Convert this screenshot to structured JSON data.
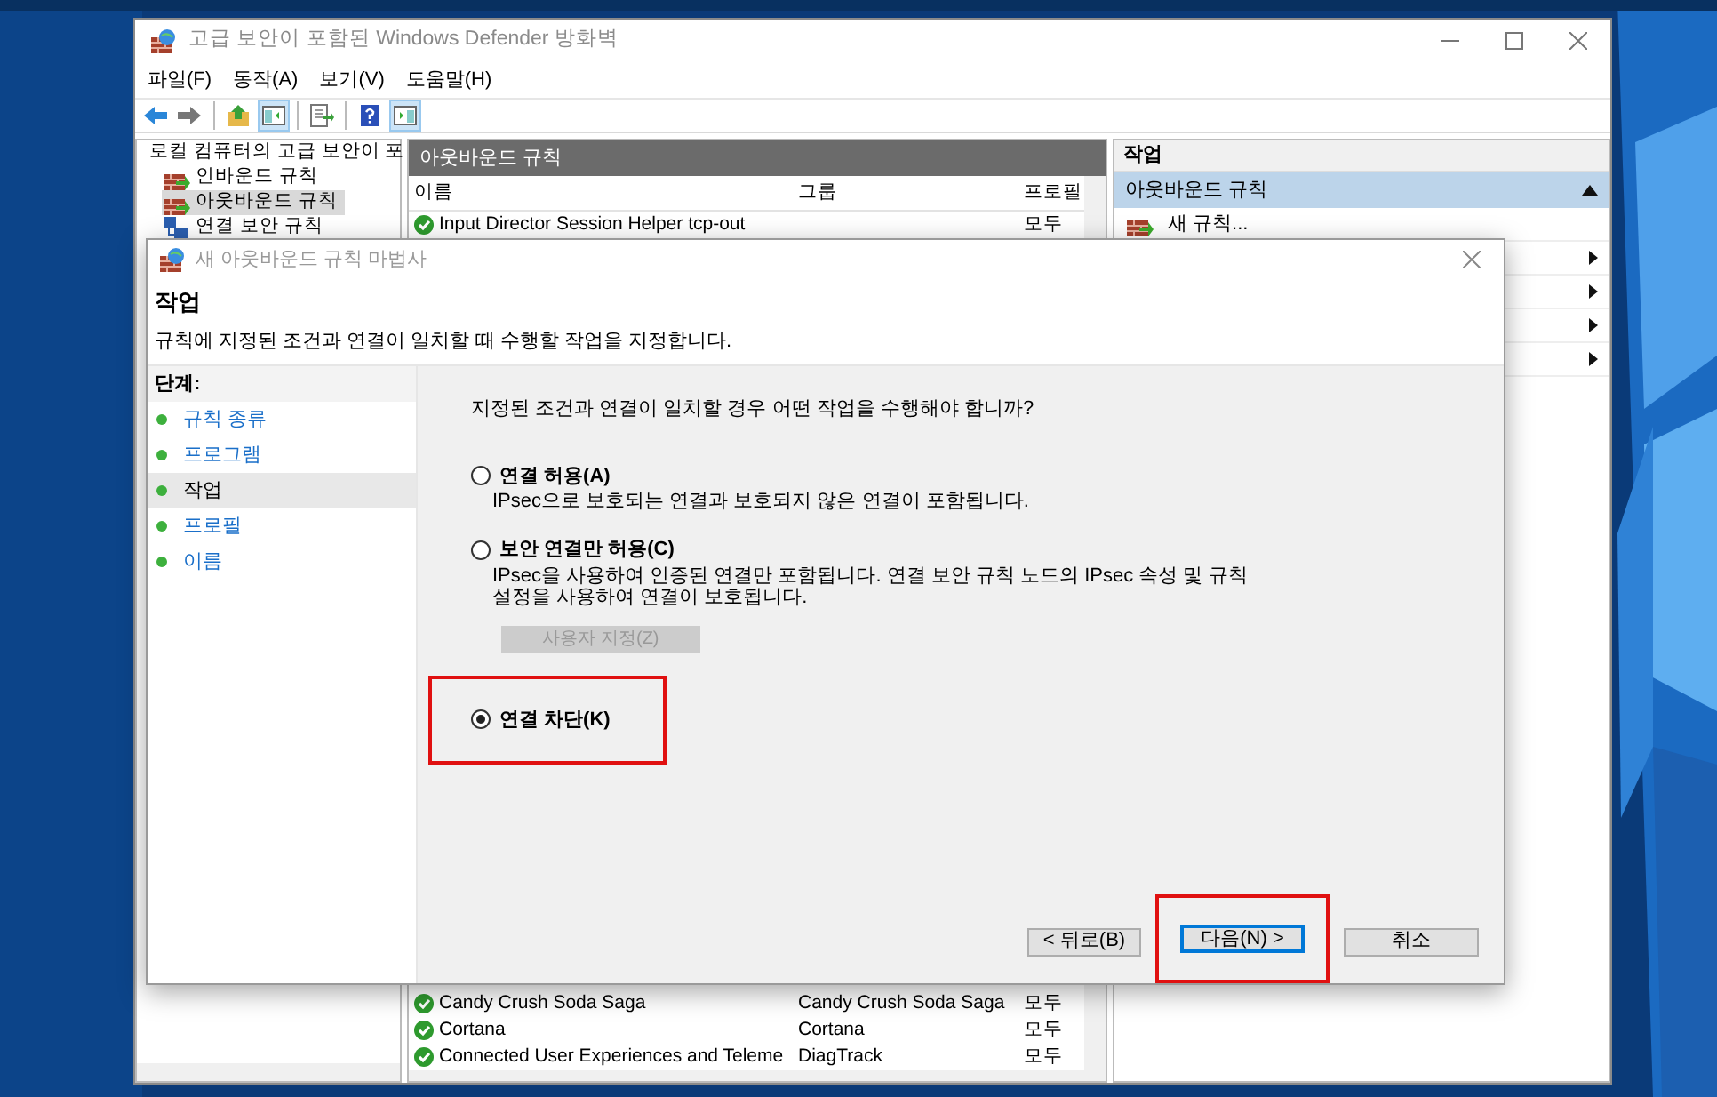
{
  "window": {
    "title": "고급 보안이 포함된 Windows Defender 방화벽"
  },
  "menu": [
    "파일(F)",
    "동작(A)",
    "보기(V)",
    "도움말(H)"
  ],
  "toolbar": [
    {
      "kind": "back",
      "pressed": false
    },
    {
      "kind": "forward",
      "pressed": false
    },
    {
      "kind": "separator"
    },
    {
      "kind": "up",
      "pressed": false
    },
    {
      "kind": "tree",
      "pressed": true
    },
    {
      "kind": "separator"
    },
    {
      "kind": "export",
      "pressed": false
    },
    {
      "kind": "separator"
    },
    {
      "kind": "help",
      "pressed": false
    },
    {
      "kind": "actions",
      "pressed": true
    }
  ],
  "tree": {
    "label": "로컬 컴퓨터의 고급 보안이 포",
    "children": [
      {
        "label": "인바운드 규칙",
        "kind": "inbound",
        "selected": false
      },
      {
        "label": "아웃바운드 규칙",
        "kind": "outbound",
        "selected": true
      },
      {
        "label": "연결 보안 규칙",
        "kind": "security",
        "selected": false
      }
    ]
  },
  "rules_pane": {
    "title": "아웃바운드 규칙",
    "columns": [
      "이름",
      "그룹",
      "프로필"
    ],
    "top_rows": [
      {
        "name": "Input Director Session Helper tcp-out",
        "profile": "모두"
      }
    ],
    "bottom_rows": [
      {
        "name": "Candy Crush Soda Saga",
        "group": "Candy Crush Soda Saga",
        "profile": "모두"
      },
      {
        "name": "Cortana",
        "group": "Cortana",
        "profile": "모두"
      },
      {
        "name": "Connected User Experiences and Teleme",
        "group": "DiagTrack",
        "profile": "모두"
      }
    ]
  },
  "actions_pane": {
    "title": "작업",
    "section": {
      "label": "아웃바운드 규칙",
      "expanded": true
    },
    "items": [
      {
        "kind": "new",
        "label": "새 규칙..."
      },
      {
        "kind": "submenu"
      },
      {
        "kind": "submenu"
      },
      {
        "kind": "submenu"
      },
      {
        "kind": "submenu"
      }
    ]
  },
  "dialog": {
    "title": "새 아웃바운드 규칙 마법사",
    "heading": "작업",
    "description": "규칙에 지정된 조건과 연결이 일치할 때 수행할 작업을 지정합니다.",
    "steps_title": "단계:",
    "steps": [
      {
        "label": "규칙 종류",
        "selected": false
      },
      {
        "label": "프로그램",
        "selected": false
      },
      {
        "label": "작업",
        "selected": true
      },
      {
        "label": "프로필",
        "selected": false
      },
      {
        "label": "이름",
        "selected": false
      }
    ],
    "question": "지정된 조건과 연결이 일치할 경우 어떤 작업을 수행해야 합니까?",
    "options": [
      {
        "label": "연결 허용(A)",
        "description": "IPsec으로 보호되는 연결과 보호되지 않은 연결이 포함됩니다.",
        "selected": false,
        "highlighted": false
      },
      {
        "label": "보안 연결만 허용(C)",
        "description": "IPsec을 사용하여 인증된 연결만 포함됩니다. 연결 보안 규칙 노드의 IPsec 속성 및 규칙 설정을 사용하여 연결이 보호됩니다.",
        "selected": false,
        "highlighted": false,
        "button": {
          "label": "사용자 지정(Z)",
          "disabled": true
        }
      },
      {
        "label": "연결 차단(K)",
        "selected": true,
        "highlighted": true
      }
    ],
    "buttons": [
      {
        "label": "< 뒤로(B)",
        "kind": "back",
        "highlighted": false
      },
      {
        "label": "다음(N) >",
        "kind": "next",
        "highlighted": true
      },
      {
        "label": "취소",
        "kind": "cancel",
        "highlighted": false
      }
    ]
  }
}
